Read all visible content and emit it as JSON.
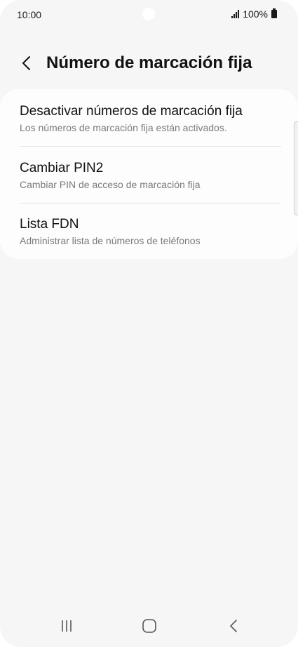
{
  "status_bar": {
    "time": "10:00",
    "battery": "100%",
    "signal_icon": "signal-icon",
    "battery_icon": "battery-icon"
  },
  "header": {
    "back_icon": "chevron-left-icon",
    "title": "Número de marcación fija"
  },
  "settings": {
    "items": [
      {
        "title": "Desactivar números de marcación fija",
        "subtitle": "Los números de marcación fija están activados."
      },
      {
        "title": "Cambiar PIN2",
        "subtitle": "Cambiar PIN de acceso de marcación fija"
      },
      {
        "title": "Lista FDN",
        "subtitle": "Administrar lista de números de teléfonos"
      }
    ]
  },
  "nav_bar": {
    "recents_icon": "recent-apps-icon",
    "home_icon": "home-icon",
    "back_icon": "back-icon"
  },
  "colors": {
    "background": "#f6f6f6",
    "card": "#fdfdfd",
    "title_text": "#111111",
    "subtitle_text": "#7a7a7a"
  }
}
